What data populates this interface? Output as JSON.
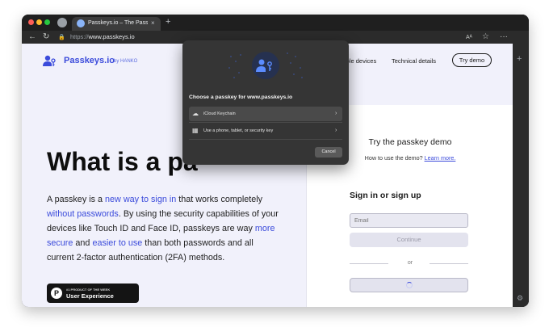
{
  "browser": {
    "tab_title": "Passkeys.io – The Passkey De",
    "tab_close": "×",
    "new_tab": "+",
    "url_scheme": "https://",
    "url_host": "www.passkeys.io",
    "icons": {
      "back": "←",
      "reload": "↻",
      "lock": "🔒",
      "reader": "Aᴬ",
      "star": "☆",
      "menu": "···",
      "sidebar_plus": "+",
      "settings": "⚙"
    }
  },
  "site": {
    "logo_text": "Passkeys.io",
    "logo_by": "by HANKO",
    "nav": {
      "compatible": "ible devices",
      "technical": "Technical details",
      "try_demo": "Try demo"
    },
    "hero_title": "What is a pa",
    "para": {
      "p1": "A passkey is a ",
      "l1": "new way to sign in",
      "p2": " that works completely ",
      "l2": "without passwords",
      "p3": ". By using the security capabilities of your devices like Touch ID and Face ID, passkeys are way ",
      "l3": "more secure",
      "p4": " and ",
      "l4": "easier to use",
      "p5": " than both passwords and all current 2-factor authentication (2FA) methods."
    },
    "badge": {
      "icon": "P",
      "small": "#1 PRODUCT OF THE WEEK",
      "big": "User Experience"
    }
  },
  "demo_panel": {
    "title": "Try the passkey demo",
    "subtitle": "How to use the demo? ",
    "learn_more": "Learn more.",
    "signin_title": "Sign in or sign up",
    "email_placeholder": "Email",
    "continue_label": "Continue",
    "or_label": "or"
  },
  "passkey_popup": {
    "title": "Choose a passkey for www.passkeys.io",
    "options": [
      {
        "label": "iCloud Keychain",
        "icon": "☁",
        "chevron": "›"
      },
      {
        "label": "Use a phone, tablet, or security key",
        "icon": "▦",
        "chevron": "›"
      }
    ],
    "cancel_label": "Cancel"
  },
  "colors": {
    "brand_blue": "#3b4bdb",
    "page_bg": "#f1f1fb",
    "popup_bg": "#353535"
  }
}
